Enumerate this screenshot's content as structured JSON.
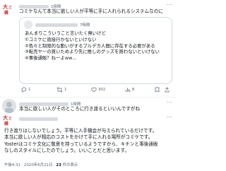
{
  "reply1": {
    "time": "1時間",
    "text": "コミケなんて本当に欲しい人が平等に手に入れられるシステムなのに"
  },
  "quote": {
    "time": "7時間",
    "lines": [
      "あんまりこういうこと言いたく無いけど",
      "①コミケに直接行かないといけない",
      "②色々と制限的な動いがするプルデカ人間に存在する必要がある",
      "③転売ヤーの買いためより先に推しのグッズを買わないといけない",
      "④事後通販？ねーよww…"
    ]
  },
  "actions": {
    "replies": "1",
    "retweets": "1",
    "likes": "302",
    "views": "8"
  },
  "reply2": {
    "time": "1時間",
    "text": "本当に欲しい人がそのところに行き渡るといいんですがね"
  },
  "main": {
    "lines": [
      "行き渡りはしないでしょう。平等に入手機会が与えられているだけです。",
      "本当に欲しい人が相応のコストをかけて手に入れる場所がコミケです。",
      "Yosterはコミケ文化に敬意を持っているようですから、キチンと事後通販",
      "なしのスタイルにしたのでしょう。いいことだと思います。"
    ],
    "timestamp": "午後4:31 · 2020年6月21日 · ",
    "views_count": "23",
    "views_label": " 件の表示"
  },
  "colors": {
    "text": "#0f1419",
    "meta": "#536471",
    "border": "#cfd9de",
    "avatar_red": "#c9302c"
  }
}
